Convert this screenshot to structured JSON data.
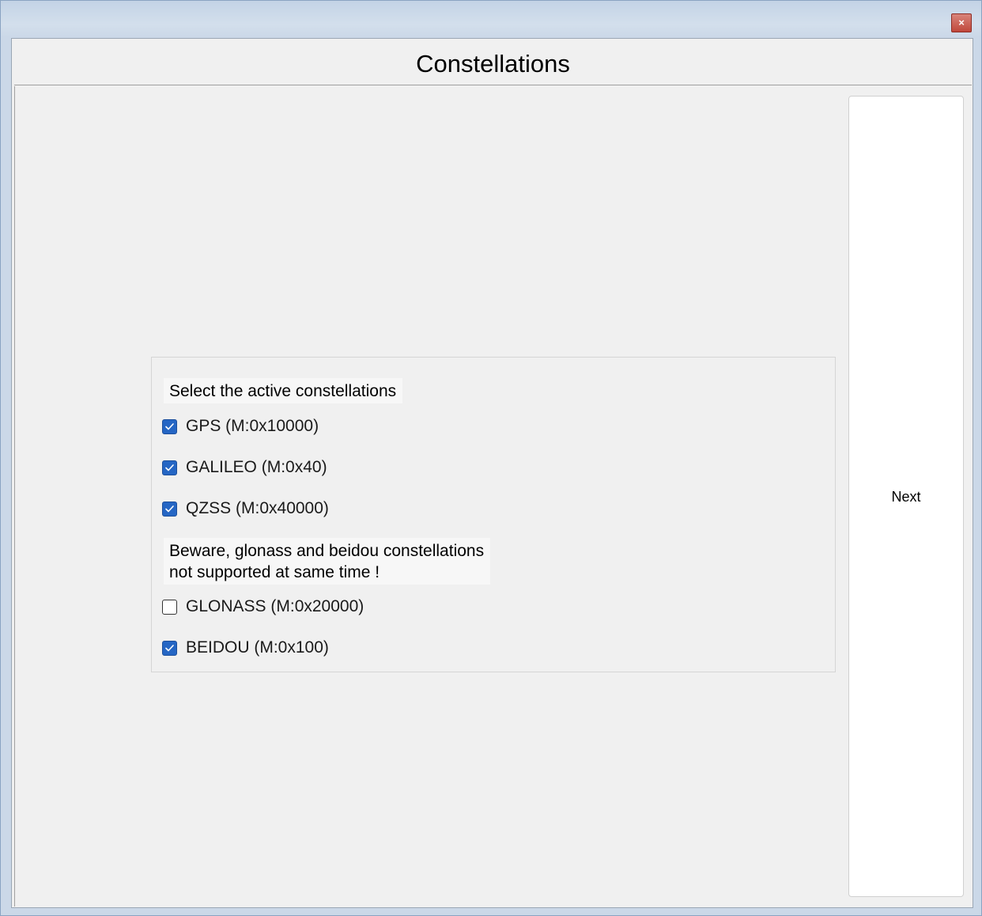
{
  "window": {
    "close_label": "×"
  },
  "header": {
    "title": "Constellations"
  },
  "panel": {
    "intro": "Select the active constellations",
    "warning_line1": "Beware, glonass and beidou constellations",
    "warning_line2": "not supported at same time !",
    "constellations": [
      {
        "label": "GPS (M:0x10000)",
        "checked": true
      },
      {
        "label": "GALILEO (M:0x40)",
        "checked": true
      },
      {
        "label": "QZSS (M:0x40000)",
        "checked": true
      },
      {
        "label": "GLONASS (M:0x20000)",
        "checked": false
      },
      {
        "label": "BEIDOU (M:0x100)",
        "checked": true
      }
    ]
  },
  "actions": {
    "next_label": "Next"
  },
  "colors": {
    "checkbox_checked": "#2566c4",
    "background": "#f0f0f0",
    "close_button": "#c0473b"
  }
}
